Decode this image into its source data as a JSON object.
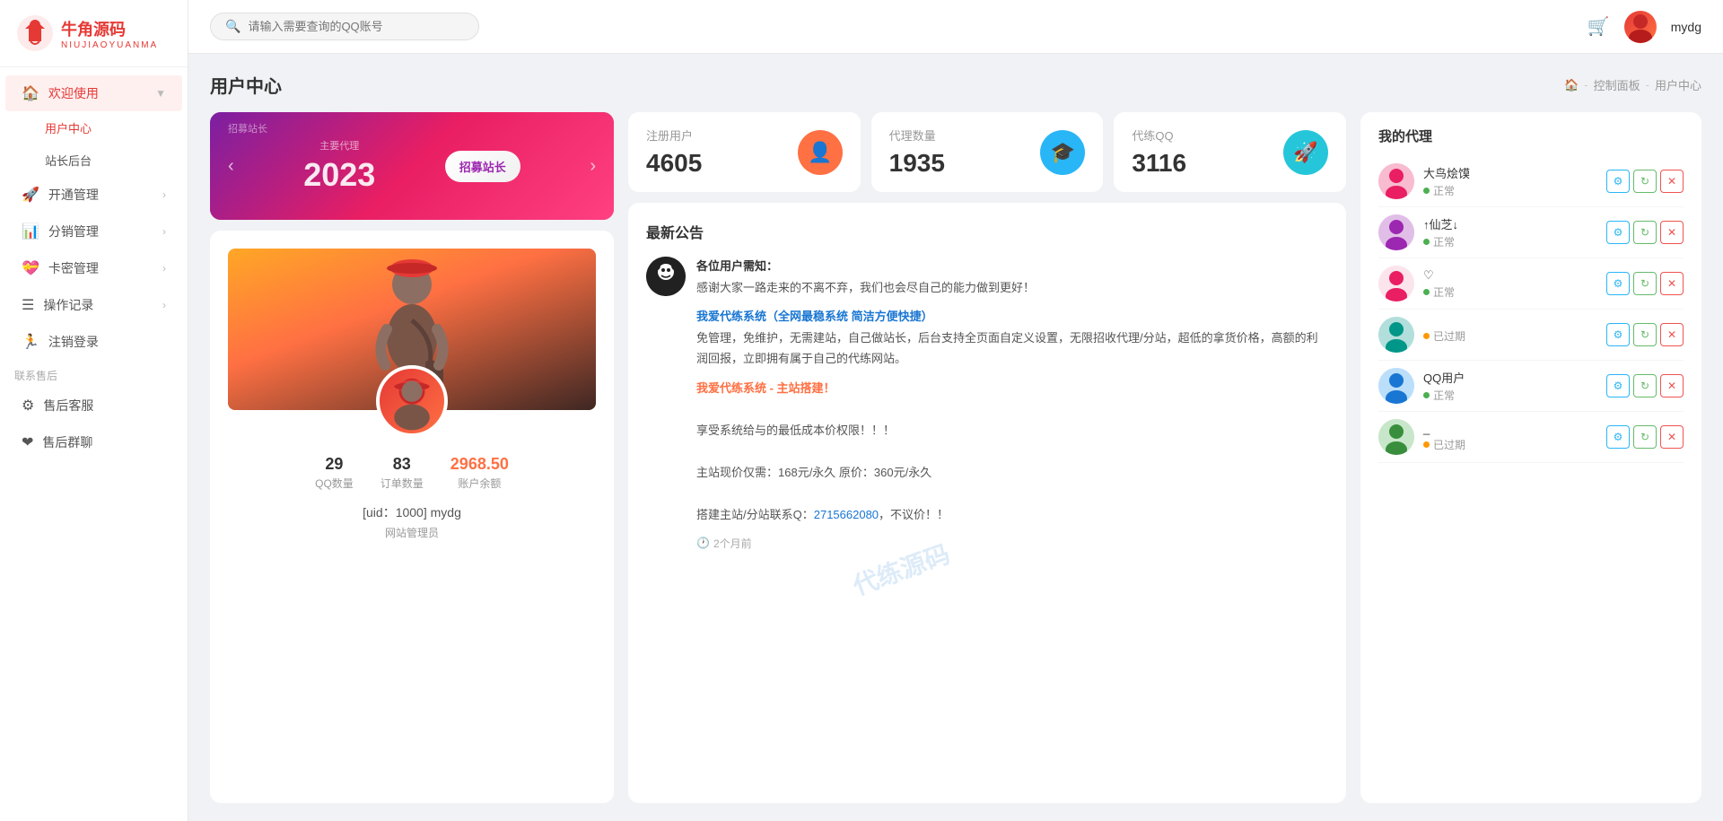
{
  "sidebar": {
    "logo": {
      "main": "牛角源码",
      "sub": "NIUJIAOYUANMA"
    },
    "welcome_section": "欢迎使用",
    "items": [
      {
        "id": "welcome",
        "label": "欢迎使用",
        "icon": "🏠",
        "hasArrow": true,
        "active": true
      },
      {
        "id": "user-center",
        "label": "用户中心",
        "sub": true,
        "active": true
      },
      {
        "id": "backend",
        "label": "站长后台",
        "sub": true
      },
      {
        "id": "open-manage",
        "label": "开通管理",
        "icon": "🚀",
        "hasArrow": true
      },
      {
        "id": "dist-manage",
        "label": "分销管理",
        "icon": "📊",
        "hasArrow": true
      },
      {
        "id": "card-manage",
        "label": "卡密管理",
        "icon": "💝",
        "hasArrow": true
      },
      {
        "id": "operation-log",
        "label": "操作记录",
        "icon": "☰",
        "hasArrow": true
      },
      {
        "id": "logout",
        "label": "注销登录",
        "icon": "🏃",
        "hasArrow": false
      }
    ],
    "after_sale_section": "联系售后",
    "after_sale_items": [
      {
        "id": "customer-service",
        "label": "售后客服",
        "icon": "⚙"
      },
      {
        "id": "after-sale-group",
        "label": "售后群聊",
        "icon": "❤"
      }
    ]
  },
  "topbar": {
    "search_placeholder": "请输入需要查询的QQ账号",
    "username": "mydg",
    "cart_icon": "🛒"
  },
  "page": {
    "title": "用户中心",
    "breadcrumbs": [
      "🏠",
      "控制面板",
      "用户中心"
    ]
  },
  "banner": {
    "label": "主要代理",
    "year": "2023",
    "main_text": "招募站长",
    "btn_text": "招募站长"
  },
  "profile": {
    "stats": [
      {
        "num": "29",
        "label": "QQ数量",
        "color": "normal"
      },
      {
        "num": "83",
        "label": "订单数量",
        "color": "normal"
      },
      {
        "num": "2968.50",
        "label": "账户余额",
        "color": "orange"
      }
    ],
    "uid": "[uid：1000] mydg",
    "role": "网站管理员"
  },
  "stat_cards": [
    {
      "title": "注册用户",
      "num": "4605",
      "icon": "👤",
      "icon_class": "icon-orange"
    },
    {
      "title": "代理数量",
      "num": "1935",
      "icon": "🎓",
      "icon_class": "icon-blue"
    },
    {
      "title": "代练QQ",
      "num": "3116",
      "icon": "🚀",
      "icon_class": "icon-teal"
    }
  ],
  "announcement": {
    "title": "最新公告",
    "avatar_emoji": "🐼",
    "header": "各位用户需知：",
    "intro": "感谢大家一路走来的不离不弃，我们也会尽自己的能力做到更好！",
    "section1_title": "我爱代练系统（全网最稳系统 简洁方便快捷）",
    "section1_body": "免管理，免维护，无需建站，自己做站长，后台支持全页面自定义设置，无限招收代理/分站，超低的拿货价格，高额的利润回报，立即拥有属于自己的代练网站。",
    "section2_title": "我爱代练系统 - 主站搭建！",
    "section2_body": "享受系统给与的最低成本价权限！！！\n\n主站现价仅需：168元/永久 原价：360元/永久\n\n搭建主站/分站联系Q：2715662080，不议价！！",
    "contact_qq": "2715662080",
    "time": "2个月前",
    "watermark": "代练源码"
  },
  "agents": {
    "title": "我的代理",
    "items": [
      {
        "name": "大鸟烩馍",
        "status": "正常",
        "status_type": "normal",
        "avatar_color": "#f48fb1",
        "avatar_emoji": "🧑"
      },
      {
        "name": "↑仙芝↓",
        "status": "正常",
        "status_type": "normal",
        "avatar_color": "#ce93d8",
        "avatar_emoji": "👩"
      },
      {
        "name": "♡",
        "status": "正常",
        "status_type": "normal",
        "avatar_color": "#f48fb1",
        "avatar_emoji": "❤"
      },
      {
        "name": "",
        "status": "已过期",
        "status_type": "expired",
        "avatar_color": "#80cbc4",
        "avatar_emoji": "🧑"
      },
      {
        "name": "QQ用户",
        "status": "正常",
        "status_type": "normal",
        "avatar_color": "#90caf9",
        "avatar_emoji": "👤"
      },
      {
        "name": "_",
        "status": "已过期",
        "status_type": "expired",
        "avatar_color": "#a5d6a7",
        "avatar_emoji": "👩"
      }
    ],
    "btn_labels": {
      "gear": "⚙",
      "refresh": "↻",
      "delete": "✕"
    }
  },
  "colors": {
    "accent": "#e53935",
    "sidebar_bg": "#ffffff",
    "main_bg": "#f0f2f5"
  }
}
